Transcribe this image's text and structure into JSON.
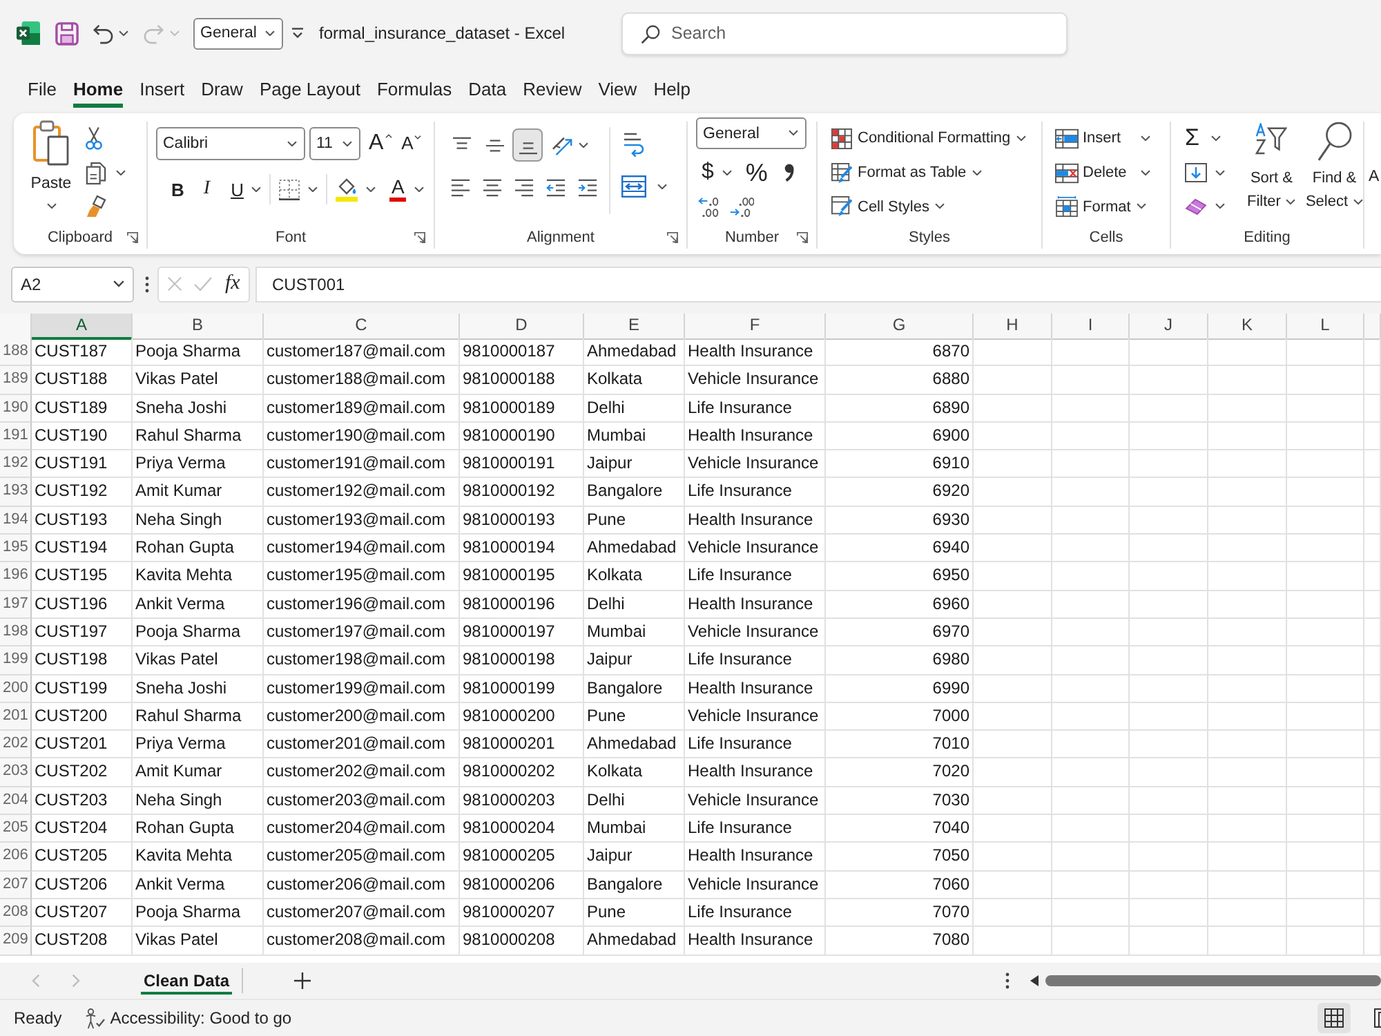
{
  "title_bar": {
    "quick_access": [
      {
        "kind": "save",
        "disabled": false
      },
      {
        "kind": "undo",
        "disabled": false
      },
      {
        "kind": "redo",
        "disabled": true
      }
    ],
    "number_format": "General",
    "title": "formal_insurance_dataset - Excel",
    "search": {
      "placeholder": "Search"
    }
  },
  "menu_tabs": [
    {
      "label": "File",
      "selected": false
    },
    {
      "label": "Home",
      "selected": true
    },
    {
      "label": "Insert",
      "selected": false
    },
    {
      "label": "Draw",
      "selected": false
    },
    {
      "label": "Page Layout",
      "selected": false
    },
    {
      "label": "Formulas",
      "selected": false
    },
    {
      "label": "Data",
      "selected": false
    },
    {
      "label": "Review",
      "selected": false
    },
    {
      "label": "View",
      "selected": false
    },
    {
      "label": "Help",
      "selected": false
    }
  ],
  "ribbon": {
    "clipboard": {
      "label": "Clipboard",
      "paste": "Paste"
    },
    "font": {
      "label": "Font",
      "font_name": "Calibri",
      "font_size": "11",
      "grow_font": "A",
      "shrink_font": "A",
      "bold": "B",
      "italic": "I",
      "underline": "U",
      "font_color": "A"
    },
    "alignment": {
      "label": "Alignment",
      "vertical": [
        {
          "kind": "top",
          "selected": false
        },
        {
          "kind": "middle",
          "selected": false
        },
        {
          "kind": "bottom",
          "selected": true
        }
      ]
    },
    "number": {
      "label": "Number",
      "format": "General",
      "currency": "$",
      "percent": "%"
    },
    "styles": {
      "label": "Styles",
      "buttons": [
        {
          "kind": "conditional",
          "label": "Conditional Formatting"
        },
        {
          "kind": "table",
          "label": "Format as Table"
        },
        {
          "kind": "cellstyle",
          "label": "Cell Styles"
        }
      ]
    },
    "cells": {
      "label": "Cells",
      "buttons": [
        {
          "kind": "insert",
          "label": "Insert"
        },
        {
          "kind": "delete",
          "label": "Delete"
        },
        {
          "kind": "format",
          "label": "Format"
        }
      ]
    },
    "editing": {
      "label": "Editing",
      "autosum": "Σ",
      "sort_filter": [
        "Sort &",
        "Filter"
      ],
      "find_select": [
        "Find &",
        "Select"
      ]
    },
    "next_group": {
      "button": "A"
    }
  },
  "formula_bar": {
    "name_box": "A2",
    "edit_buttons": [
      {
        "kind": "cancel",
        "disabled": true
      },
      {
        "kind": "enter",
        "disabled": true
      }
    ],
    "function_button": "fx",
    "formula": "CUST001"
  },
  "sheet": {
    "columns": [
      {
        "label": "A",
        "selected": true
      },
      {
        "label": "B",
        "selected": false
      },
      {
        "label": "C",
        "selected": false
      },
      {
        "label": "D",
        "selected": false
      },
      {
        "label": "E",
        "selected": false
      },
      {
        "label": "F",
        "selected": false
      },
      {
        "label": "G",
        "selected": false
      },
      {
        "label": "H",
        "selected": false
      },
      {
        "label": "I",
        "selected": false
      },
      {
        "label": "J",
        "selected": false
      },
      {
        "label": "K",
        "selected": false
      },
      {
        "label": "L",
        "selected": false
      }
    ],
    "rows": [
      {
        "row_number": "188",
        "cells": [
          "CUST187",
          "Pooja Sharma",
          "customer187@mail.com",
          "9810000187",
          "Ahmedabad",
          "Health Insurance",
          "6870"
        ]
      },
      {
        "row_number": "189",
        "cells": [
          "CUST188",
          "Vikas Patel",
          "customer188@mail.com",
          "9810000188",
          "Kolkata",
          "Vehicle Insurance",
          "6880"
        ]
      },
      {
        "row_number": "190",
        "cells": [
          "CUST189",
          "Sneha Joshi",
          "customer189@mail.com",
          "9810000189",
          "Delhi",
          "Life Insurance",
          "6890"
        ]
      },
      {
        "row_number": "191",
        "cells": [
          "CUST190",
          "Rahul Sharma",
          "customer190@mail.com",
          "9810000190",
          "Mumbai",
          "Health Insurance",
          "6900"
        ]
      },
      {
        "row_number": "192",
        "cells": [
          "CUST191",
          "Priya Verma",
          "customer191@mail.com",
          "9810000191",
          "Jaipur",
          "Vehicle Insurance",
          "6910"
        ]
      },
      {
        "row_number": "193",
        "cells": [
          "CUST192",
          "Amit Kumar",
          "customer192@mail.com",
          "9810000192",
          "Bangalore",
          "Life Insurance",
          "6920"
        ]
      },
      {
        "row_number": "194",
        "cells": [
          "CUST193",
          "Neha Singh",
          "customer193@mail.com",
          "9810000193",
          "Pune",
          "Health Insurance",
          "6930"
        ]
      },
      {
        "row_number": "195",
        "cells": [
          "CUST194",
          "Rohan Gupta",
          "customer194@mail.com",
          "9810000194",
          "Ahmedabad",
          "Vehicle Insurance",
          "6940"
        ]
      },
      {
        "row_number": "196",
        "cells": [
          "CUST195",
          "Kavita Mehta",
          "customer195@mail.com",
          "9810000195",
          "Kolkata",
          "Life Insurance",
          "6950"
        ]
      },
      {
        "row_number": "197",
        "cells": [
          "CUST196",
          "Ankit Verma",
          "customer196@mail.com",
          "9810000196",
          "Delhi",
          "Health Insurance",
          "6960"
        ]
      },
      {
        "row_number": "198",
        "cells": [
          "CUST197",
          "Pooja Sharma",
          "customer197@mail.com",
          "9810000197",
          "Mumbai",
          "Vehicle Insurance",
          "6970"
        ]
      },
      {
        "row_number": "199",
        "cells": [
          "CUST198",
          "Vikas Patel",
          "customer198@mail.com",
          "9810000198",
          "Jaipur",
          "Life Insurance",
          "6980"
        ]
      },
      {
        "row_number": "200",
        "cells": [
          "CUST199",
          "Sneha Joshi",
          "customer199@mail.com",
          "9810000199",
          "Bangalore",
          "Health Insurance",
          "6990"
        ]
      },
      {
        "row_number": "201",
        "cells": [
          "CUST200",
          "Rahul Sharma",
          "customer200@mail.com",
          "9810000200",
          "Pune",
          "Vehicle Insurance",
          "7000"
        ]
      },
      {
        "row_number": "202",
        "cells": [
          "CUST201",
          "Priya Verma",
          "customer201@mail.com",
          "9810000201",
          "Ahmedabad",
          "Life Insurance",
          "7010"
        ]
      },
      {
        "row_number": "203",
        "cells": [
          "CUST202",
          "Amit Kumar",
          "customer202@mail.com",
          "9810000202",
          "Kolkata",
          "Health Insurance",
          "7020"
        ]
      },
      {
        "row_number": "204",
        "cells": [
          "CUST203",
          "Neha Singh",
          "customer203@mail.com",
          "9810000203",
          "Delhi",
          "Vehicle Insurance",
          "7030"
        ]
      },
      {
        "row_number": "205",
        "cells": [
          "CUST204",
          "Rohan Gupta",
          "customer204@mail.com",
          "9810000204",
          "Mumbai",
          "Life Insurance",
          "7040"
        ]
      },
      {
        "row_number": "206",
        "cells": [
          "CUST205",
          "Kavita Mehta",
          "customer205@mail.com",
          "9810000205",
          "Jaipur",
          "Health Insurance",
          "7050"
        ]
      },
      {
        "row_number": "207",
        "cells": [
          "CUST206",
          "Ankit Verma",
          "customer206@mail.com",
          "9810000206",
          "Bangalore",
          "Vehicle Insurance",
          "7060"
        ]
      },
      {
        "row_number": "208",
        "cells": [
          "CUST207",
          "Pooja Sharma",
          "customer207@mail.com",
          "9810000207",
          "Pune",
          "Life Insurance",
          "7070"
        ]
      },
      {
        "row_number": "209",
        "cells": [
          "CUST208",
          "Vikas Patel",
          "customer208@mail.com",
          "9810000208",
          "Ahmedabad",
          "Health Insurance",
          "7080"
        ]
      }
    ]
  },
  "sheet_tab_bar": {
    "nav": [
      {
        "kind": "previous",
        "disabled": true
      },
      {
        "kind": "next",
        "disabled": true
      }
    ],
    "tabs": [
      {
        "label": "Clean Data",
        "selected": true
      }
    ]
  },
  "status_bar": {
    "mode": "Ready",
    "accessibility": "Accessibility: Good to go",
    "views": [
      {
        "kind": "normal",
        "selected": true
      },
      {
        "kind": "pagelayout",
        "selected": false
      }
    ]
  }
}
